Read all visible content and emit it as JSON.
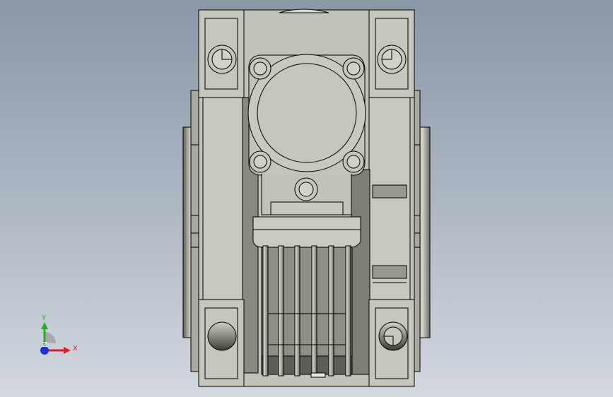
{
  "viewport": {
    "background_top": "#8a97a6",
    "background_bottom": "#d3d8e0"
  },
  "model": {
    "name": "worm-gear-reducer",
    "body_color": "#c5c5bb",
    "shadow_color": "#7c7c70",
    "edge_color": "#000000"
  },
  "triad": {
    "x_label": "X",
    "y_label": "Y",
    "z_label": "Z",
    "x_color": "#e02020",
    "y_color": "#20b020",
    "z_color": "#2030e0"
  }
}
